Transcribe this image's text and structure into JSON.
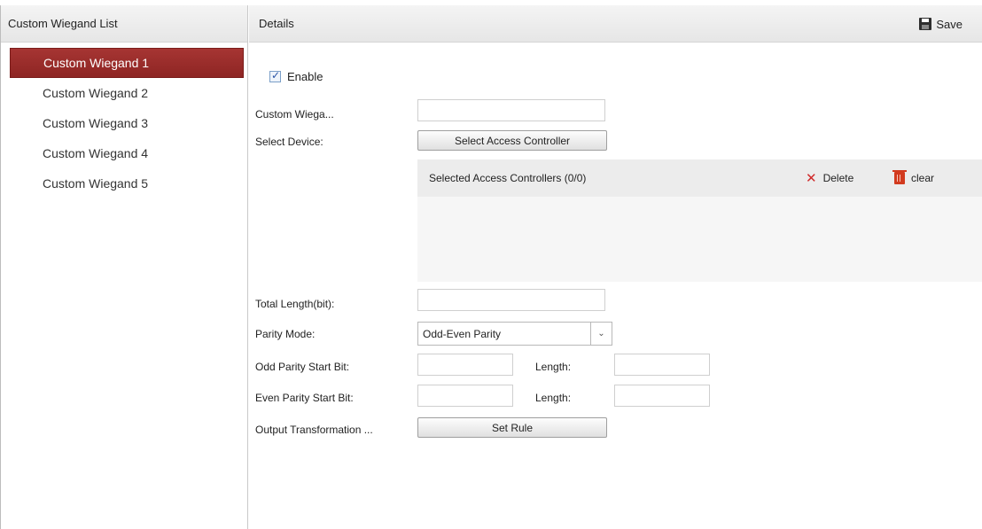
{
  "left_panel": {
    "title": "Custom Wiegand List",
    "items": [
      {
        "label": "Custom Wiegand 1",
        "selected": true
      },
      {
        "label": "Custom Wiegand 2",
        "selected": false
      },
      {
        "label": "Custom Wiegand 3",
        "selected": false
      },
      {
        "label": "Custom Wiegand 4",
        "selected": false
      },
      {
        "label": "Custom Wiegand 5",
        "selected": false
      }
    ]
  },
  "details": {
    "title": "Details",
    "save_label": "Save",
    "enable_label": "Enable",
    "enable_checked": true,
    "custom_wiegand_label": "Custom Wiega...",
    "custom_wiegand_value": "",
    "select_device_label": "Select Device:",
    "select_controller_button": "Select Access Controller",
    "selected_controllers_title": "Selected Access Controllers (0/0)",
    "delete_label": "Delete",
    "clear_label": "clear",
    "total_length_label": "Total Length(bit):",
    "total_length_value": "",
    "parity_mode_label": "Parity Mode:",
    "parity_mode_value": "Odd-Even Parity",
    "odd_parity_start_label": "Odd Parity Start Bit:",
    "odd_parity_start_value": "",
    "odd_length_label": "Length:",
    "odd_length_value": "",
    "even_parity_start_label": "Even Parity Start Bit:",
    "even_parity_start_value": "",
    "even_length_label": "Length:",
    "even_length_value": "",
    "output_transformation_label": "Output Transformation ...",
    "set_rule_button": "Set Rule"
  },
  "colors": {
    "selected_item_bg": "#9a2d2b",
    "delete_icon": "#d02a2a",
    "clear_icon": "#d23a1e"
  }
}
